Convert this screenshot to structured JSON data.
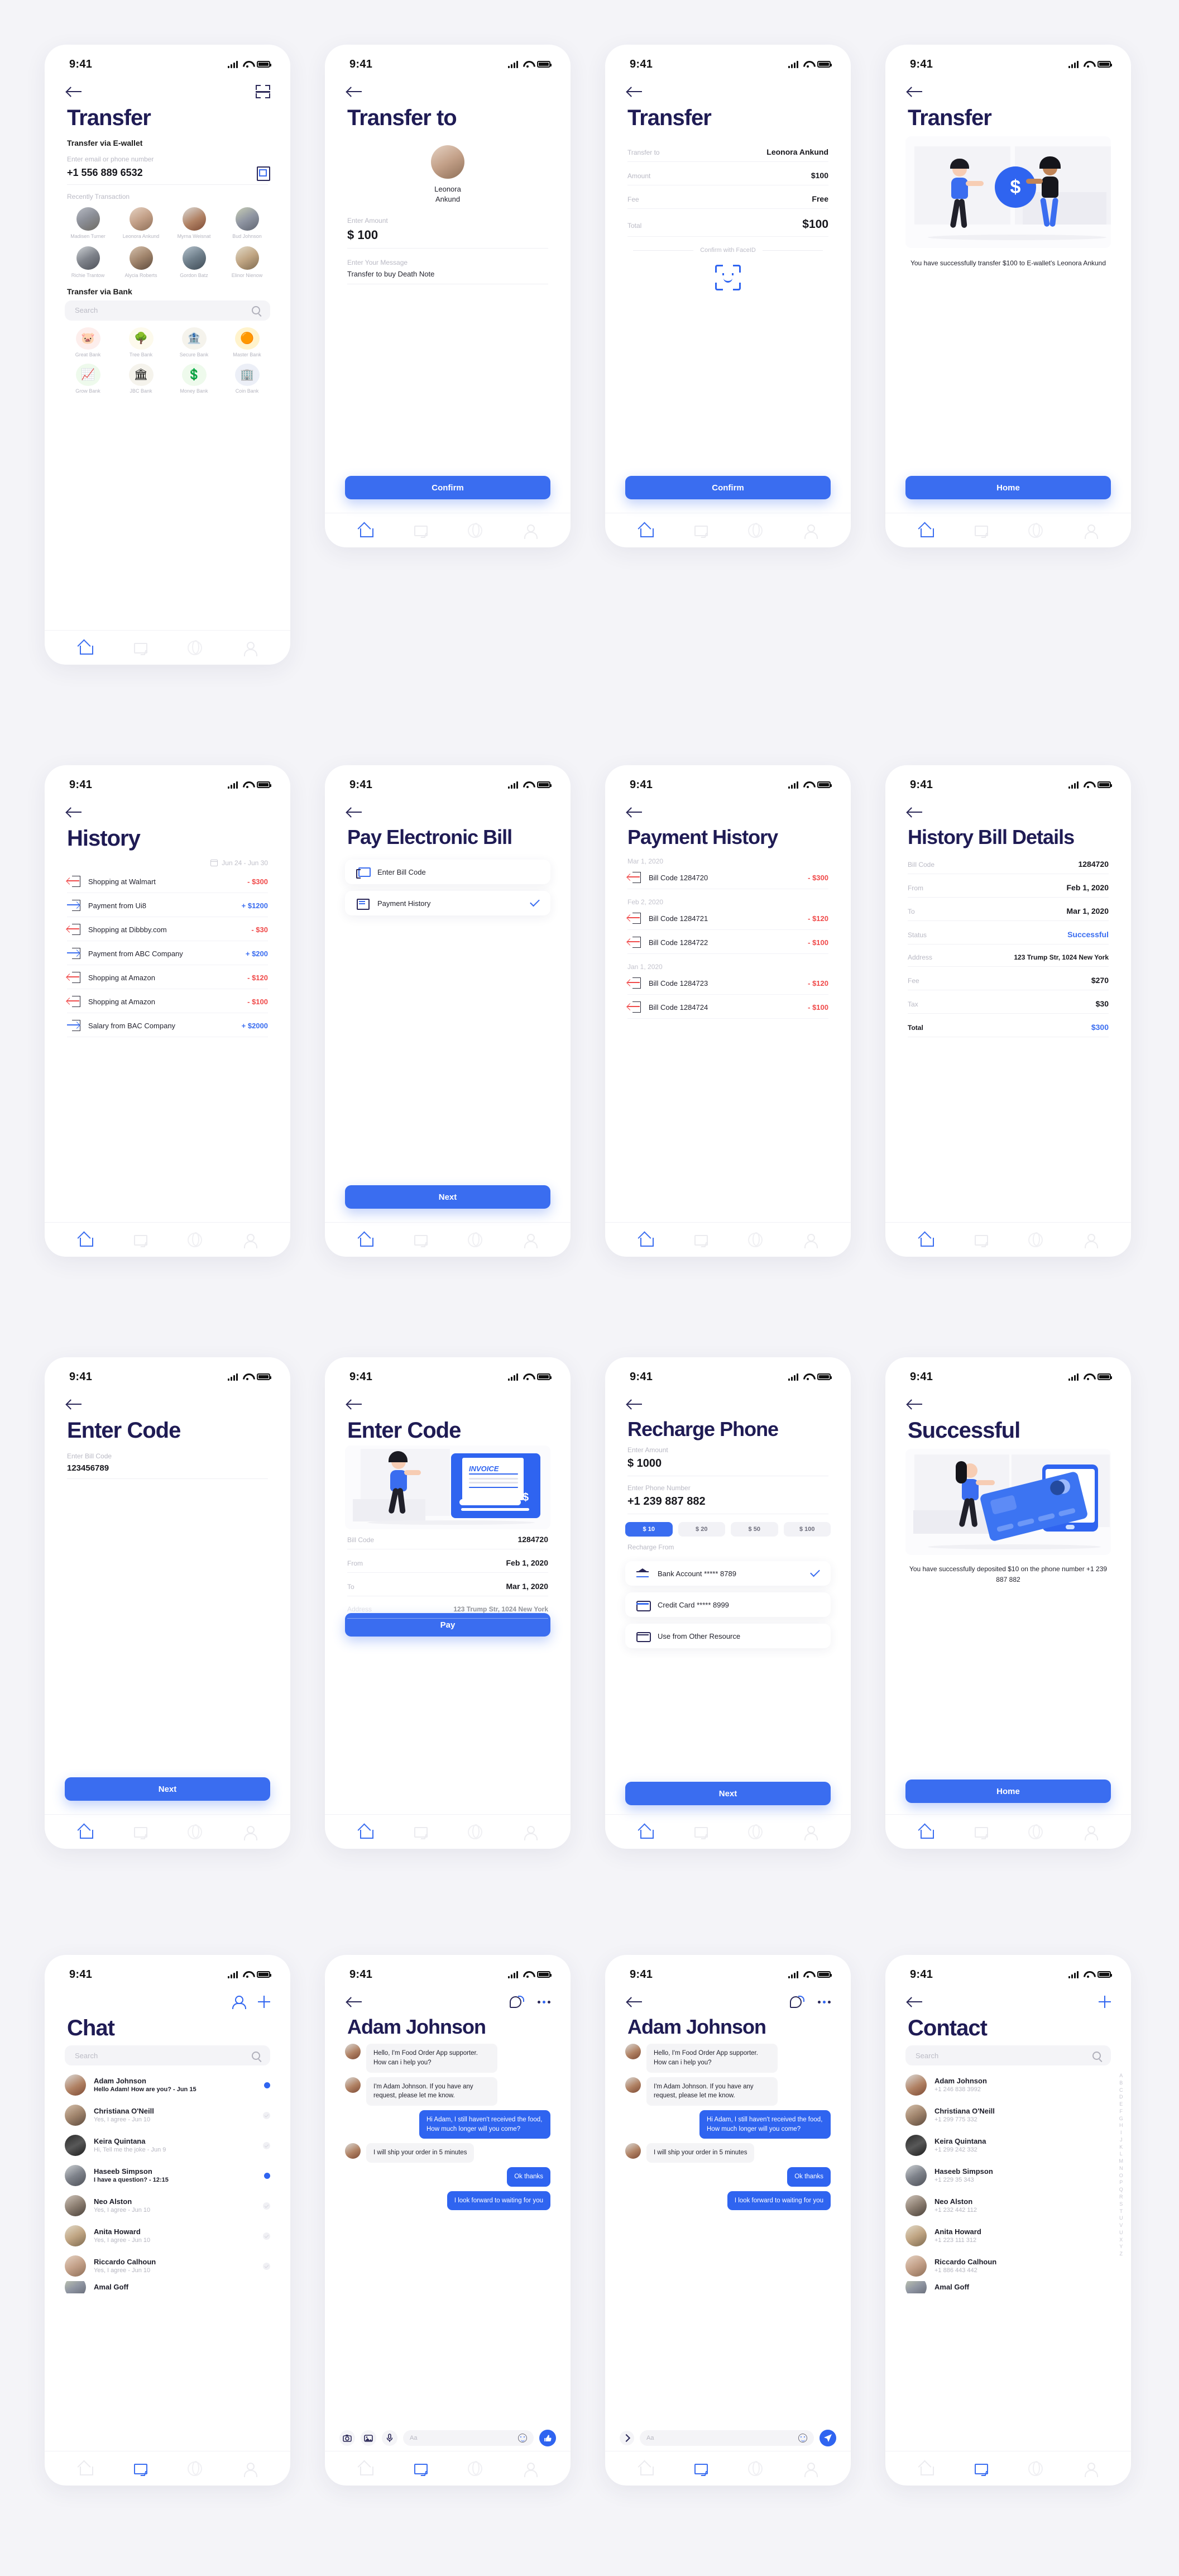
{
  "status_bar": {
    "time": "9:41"
  },
  "colors": {
    "primary": "#2f64f0",
    "title": "#1f1b54",
    "negative": "#f04a4a",
    "positive": "#3a6df0"
  },
  "screens": {
    "transfer": {
      "title": "Transfer",
      "section_ewallet": "Transfer via E-wallet",
      "input_label": "Enter email or phone number",
      "input_value": "+1 556 889 6532",
      "recent_label": "Recently Transaction",
      "recent_contacts": [
        {
          "name": "Madisen Turner"
        },
        {
          "name": "Leonora Ankund"
        },
        {
          "name": "Myrna Weisnat"
        },
        {
          "name": "Bud Johnson"
        },
        {
          "name": "Richie Trantow"
        },
        {
          "name": "Alycia Roberts"
        },
        {
          "name": "Gordon Batz"
        },
        {
          "name": "Elinor Nienow"
        }
      ],
      "section_bank": "Transfer via Bank",
      "search_placeholder": "Search",
      "banks": [
        {
          "name": "Great Bank",
          "glyph": "🐷",
          "bg": "#fdeeec"
        },
        {
          "name": "Tree Bank",
          "glyph": "🌳",
          "bg": "#fdfaec"
        },
        {
          "name": "Secure Bank",
          "glyph": "🏦",
          "bg": "#f5f3ec"
        },
        {
          "name": "Master Bank",
          "glyph": "🟠",
          "bg": "#fff3cc"
        },
        {
          "name": "Grow Bank",
          "glyph": "📈",
          "bg": "#eefaec"
        },
        {
          "name": "JBC Bank",
          "glyph": "🏛",
          "bg": "#f5f3ec"
        },
        {
          "name": "Money Bank",
          "glyph": "💲",
          "bg": "#eefaec"
        },
        {
          "name": "Coin Bank",
          "glyph": "🏢",
          "bg": "#eceff7"
        }
      ]
    },
    "transfer_to": {
      "title": "Transfer to",
      "recipient": "Leonora Ankund",
      "amount_label": "Enter Amount",
      "amount_value": "$ 100",
      "message_label": "Enter Your Message",
      "message_value": "Transfer to buy Death Note",
      "confirm_button": "Confirm"
    },
    "transfer_confirm": {
      "title": "Transfer",
      "rows": [
        {
          "key": "Transfer to",
          "value": "Leonora Ankund"
        },
        {
          "key": "Amount",
          "value": "$100"
        },
        {
          "key": "Fee",
          "value": "Free"
        },
        {
          "key": "Total",
          "value": "$100"
        }
      ],
      "faceid_label": "Confirm with FaceID",
      "confirm_button": "Confirm"
    },
    "transfer_success": {
      "title": "Transfer",
      "message": "You have successfully transfer $100 to E-wallet's Leonora Ankund",
      "home_button": "Home"
    },
    "history": {
      "title": "History",
      "date_range": "Jun 24 - Jun 30",
      "rows": [
        {
          "text": "Shopping at Walmart",
          "amount": "- $300",
          "dir": "out"
        },
        {
          "text": "Payment from Ui8",
          "amount": "+ $1200",
          "dir": "in"
        },
        {
          "text": "Shopping at Dibbby.com",
          "amount": "- $30",
          "dir": "out"
        },
        {
          "text": "Payment from ABC Company",
          "amount": "+ $200",
          "dir": "in"
        },
        {
          "text": "Shopping at Amazon",
          "amount": "- $120",
          "dir": "out"
        },
        {
          "text": "Shopping at Amazon",
          "amount": "- $100",
          "dir": "out"
        },
        {
          "text": "Salary from BAC Company",
          "amount": "+ $2000",
          "dir": "in"
        }
      ]
    },
    "pay_bill": {
      "title": "Pay Electronic Bill",
      "options": [
        {
          "label": "Enter Bill Code",
          "checked": false
        },
        {
          "label": "Payment History",
          "checked": true
        }
      ],
      "next_button": "Next"
    },
    "payment_history": {
      "title": "Payment History",
      "groups": [
        {
          "date": "Mar 1, 2020",
          "rows": [
            {
              "text": "Bill Code 1284720",
              "amount": "- $300"
            }
          ]
        },
        {
          "date": "Feb 2, 2020",
          "rows": [
            {
              "text": "Bill Code 1284721",
              "amount": "- $120"
            },
            {
              "text": "Bill Code 1284722",
              "amount": "- $100"
            }
          ]
        },
        {
          "date": "Jan 1, 2020",
          "rows": [
            {
              "text": "Bill Code 1284723",
              "amount": "- $120"
            },
            {
              "text": "Bill Code 1284724",
              "amount": "- $100"
            }
          ]
        }
      ]
    },
    "bill_details": {
      "title": "History Bill Details",
      "rows": [
        {
          "key": "Bill Code",
          "value": "1284720"
        },
        {
          "key": "From",
          "value": "Feb 1, 2020"
        },
        {
          "key": "To",
          "value": "Mar 1, 2020"
        },
        {
          "key": "Status",
          "value": "Successful"
        },
        {
          "key": "Address",
          "value": "123 Trump Str, 1024 New York"
        },
        {
          "key": "Fee",
          "value": "$270"
        },
        {
          "key": "Tax",
          "value": "$30"
        },
        {
          "key": "Total",
          "value": "$300"
        }
      ]
    },
    "enter_code": {
      "title": "Enter Code",
      "label": "Enter Bill Code",
      "value": "123456789",
      "next_button": "Next"
    },
    "enter_code_detail": {
      "title": "Enter Code",
      "invoice_word": "INVOICE",
      "rows": [
        {
          "key": "Bill Code",
          "value": "1284720"
        },
        {
          "key": "From",
          "value": "Feb 1, 2020"
        },
        {
          "key": "To",
          "value": "Mar 1, 2020"
        },
        {
          "key": "Address",
          "value": "123 Trump Str, 1024 New York"
        }
      ],
      "pay_button": "Pay"
    },
    "recharge": {
      "title": "Recharge Phone",
      "amount_label": "Enter Amount",
      "amount_value": "$ 1000",
      "phone_label": "Enter Phone Number",
      "phone_value": "+1 239 887 882",
      "chips": [
        {
          "label": "$ 10",
          "selected": true
        },
        {
          "label": "$ 20",
          "selected": false
        },
        {
          "label": "$ 50",
          "selected": false
        },
        {
          "label": "$ 100",
          "selected": false
        }
      ],
      "source_label": "Recharge From",
      "sources": [
        {
          "label": "Bank Account ***** 8789",
          "checked": true,
          "icon": "bank-icon"
        },
        {
          "label": "Credit Card ***** 8999",
          "checked": false,
          "icon": "credit-card-icon"
        },
        {
          "label": "Use from Other Resource",
          "checked": false,
          "icon": "other-resource-icon"
        }
      ],
      "next_button": "Next"
    },
    "recharge_success": {
      "title": "Successful",
      "message": "You have successfully deposited $10 on the phone number +1 239 887 882",
      "home_button": "Home"
    },
    "chat_list": {
      "title": "Chat",
      "search_placeholder": "Search",
      "rows": [
        {
          "name": "Adam Johnson",
          "preview": "Hello Adam! How are you? - Jun 15",
          "unread": true,
          "av": "av-c"
        },
        {
          "name": "Christiana O'Neill",
          "preview": "Yes, I agree - Jun 10",
          "unread": false,
          "av": "av-f"
        },
        {
          "name": "Keira Quintana",
          "preview": "Hi, Tell me the joke - Jun 9",
          "unread": false,
          "av": "av-i"
        },
        {
          "name": "Haseeb Simpson",
          "preview": "I have a question? - 12:15",
          "unread": true,
          "av": "av-e"
        },
        {
          "name": "Neo Alston",
          "preview": "Yes, I agree - Jun 10",
          "unread": false,
          "av": "av-j"
        },
        {
          "name": "Anita Howard",
          "preview": "Yes, I agree - Jun 10",
          "unread": false,
          "av": "av-h"
        },
        {
          "name": "Riccardo Calhoun",
          "preview": "Yes, I agree - Jun 10",
          "unread": false,
          "av": "av-b"
        },
        {
          "name": "Amal Goff",
          "preview": "",
          "unread": false,
          "av": "av-d"
        }
      ]
    },
    "chat_thread": {
      "title": "Adam Johnson",
      "messages": [
        {
          "from": "them",
          "text": "Hello, I'm Food Order App supporter. How can i help you?"
        },
        {
          "from": "them",
          "text": "I'm Adam Johnson. If you have any request, please let me know."
        },
        {
          "from": "me",
          "text": "Hi Adam, I still haven't received the food, How much longer will you come?"
        },
        {
          "from": "them",
          "text": "I will ship your order in 5 minutes"
        },
        {
          "from": "me",
          "text": "Ok thanks"
        },
        {
          "from": "me",
          "text": "I look forward to waiting for you"
        }
      ],
      "composer_placeholder": "Aa"
    },
    "contacts": {
      "title": "Contact",
      "search_placeholder": "Search",
      "alphabet": [
        "A",
        "B",
        "C",
        "D",
        "E",
        "F",
        "G",
        "H",
        "I",
        "J",
        "K",
        "L",
        "M",
        "N",
        "O",
        "P",
        "Q",
        "R",
        "S",
        "T",
        "U",
        "V",
        "U",
        "X",
        "Y",
        "Z"
      ],
      "rows": [
        {
          "name": "Adam Johnson",
          "phone": "+1 246 838 3992",
          "av": "av-c"
        },
        {
          "name": "Christiana O'Neill",
          "phone": "+1 299 775 332",
          "av": "av-f"
        },
        {
          "name": "Keira Quintana",
          "phone": "+1 299 242 332",
          "av": "av-i"
        },
        {
          "name": "Haseeb Simpson",
          "phone": "+1 229 35 343",
          "av": "av-e"
        },
        {
          "name": "Neo Alston",
          "phone": "+1 232 442 112",
          "av": "av-j"
        },
        {
          "name": "Anita Howard",
          "phone": "+1 223 111 312",
          "av": "av-h"
        },
        {
          "name": "Riccardo Calhoun",
          "phone": "+1 886 443 442",
          "av": "av-b"
        },
        {
          "name": "Amal Goff",
          "phone": "",
          "av": "av-d"
        }
      ]
    }
  }
}
